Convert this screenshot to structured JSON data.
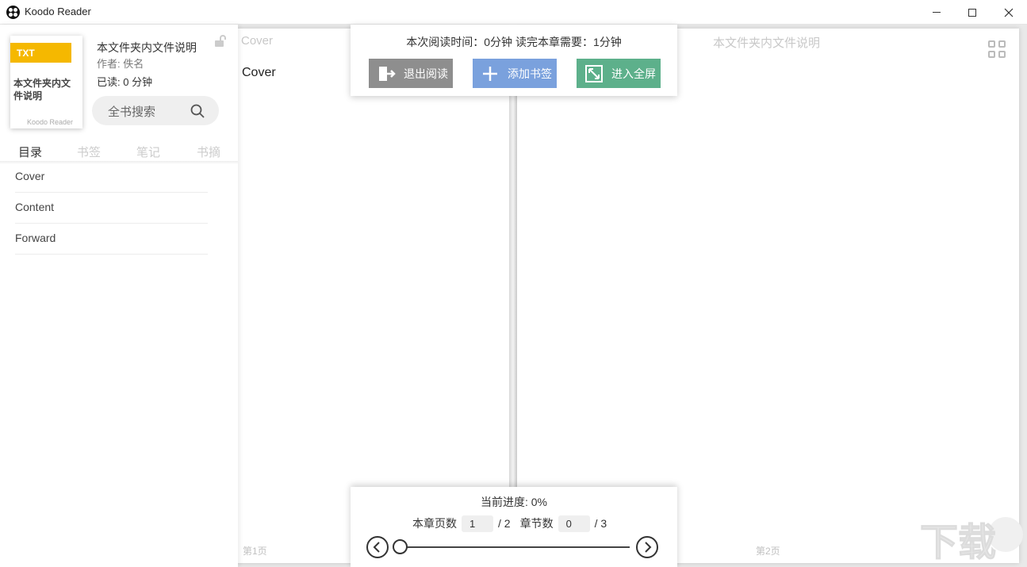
{
  "window": {
    "title": "Koodo Reader"
  },
  "sidebar": {
    "cover": {
      "format_tag": "TXT",
      "title": "本文件夹内文件说明",
      "brand": "Koodo Reader"
    },
    "book_title": "本文件夹内文件说明",
    "author": "作者: 佚名",
    "read_time": "已读: 0 分钟",
    "search_placeholder": "全书搜索",
    "tabs": [
      {
        "label": "目录",
        "active": true
      },
      {
        "label": "书签",
        "active": false
      },
      {
        "label": "笔记",
        "active": false
      },
      {
        "label": "书摘",
        "active": false
      }
    ],
    "toc": [
      {
        "label": "Cover"
      },
      {
        "label": "Content"
      },
      {
        "label": "Forward"
      }
    ]
  },
  "reader": {
    "left_header": "Cover",
    "left_content": "Cover",
    "right_header": "本文件夹内文件说明",
    "left_page_number": "第1页",
    "right_page_number": "第2页"
  },
  "top_panel": {
    "reading_time_text": "本次阅读时间：0分钟    读完本章需要：1分钟",
    "buttons": {
      "exit": "退出阅读",
      "add_bookmark": "添加书签",
      "fullscreen": "进入全屏"
    },
    "colors": {
      "exit": "#8e8e8e",
      "add_bookmark": "#7aa1dd",
      "fullscreen": "#5db08b"
    }
  },
  "bottom_panel": {
    "progress_text": "当前进度: 0%",
    "progress_fraction": 0,
    "chapter_page_label": "本章页数",
    "chapter_page_value": "1",
    "chapter_page_total": "/ 2",
    "section_label": "章节数",
    "section_value": "0",
    "section_total": "/ 3"
  },
  "icons": {
    "lock": "unlock-icon",
    "search": "search-icon",
    "grid": "grid-icon",
    "exit": "exit-icon",
    "bookmark": "plus-icon",
    "fullscreen": "expand-icon",
    "prev": "chevron-left-icon",
    "next": "chevron-right-icon"
  }
}
